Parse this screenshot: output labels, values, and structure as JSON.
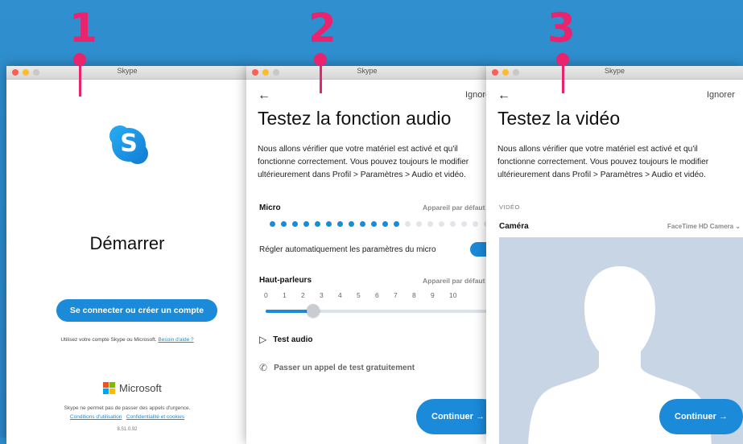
{
  "steps": [
    "1",
    "2",
    "3"
  ],
  "window_title": "Skype",
  "screen1": {
    "logo_letter": "S",
    "title": "Démarrer",
    "signin_button": "Se connecter ou créer un compte",
    "help_prefix": "Utilisez votre compte Skype ou Microsoft.",
    "help_link": "Besoin d'aide ?",
    "brand": "Microsoft",
    "disclaimer": "Skype ne permet pas de passer des appels d'urgence.",
    "terms_link": "Conditions d'utilisation",
    "privacy_link": "Confidentialité et cookies",
    "version": "8.51.0.92"
  },
  "screen2": {
    "back": "←",
    "skip": "Ignorer",
    "title": "Testez la fonction audio",
    "description": "Nous allons vérifier que votre matériel est activé et qu'il fonctionne correctement. Vous pouvez toujours le modifier ultérieurement dans Profil > Paramètres > Audio et vidéo.",
    "mic_label": "Micro",
    "mic_device": "Appareil par défaut",
    "mic_level_active": 12,
    "mic_level_total": 20,
    "auto_mic_label": "Régler automatiquement les paramètres du micro",
    "auto_mic_on": true,
    "speakers_label": "Haut-parleurs",
    "speakers_device": "Appareil par défaut",
    "volume_ticks": [
      "0",
      "1",
      "2",
      "3",
      "4",
      "5",
      "6",
      "7",
      "8",
      "9",
      "10"
    ],
    "volume_value": 2.5,
    "test_audio": "Test audio",
    "test_call": "Passer un appel de test gratuitement",
    "continue": "Continuer →"
  },
  "screen3": {
    "back": "←",
    "skip": "Ignorer",
    "title": "Testez la vidéo",
    "description": "Nous allons vérifier que votre matériel est activé et qu'il fonctionne correctement. Vous pouvez toujours le modifier ultérieurement dans Profil > Paramètres > Audio et vidéo.",
    "section": "VIDÉO",
    "camera_label": "Caméra",
    "camera_device": "FaceTime HD Camera",
    "continue": "Continuer →"
  },
  "colors": {
    "accent": "#1a8ad9",
    "pin": "#e8246e",
    "background": "#2a86c6"
  }
}
